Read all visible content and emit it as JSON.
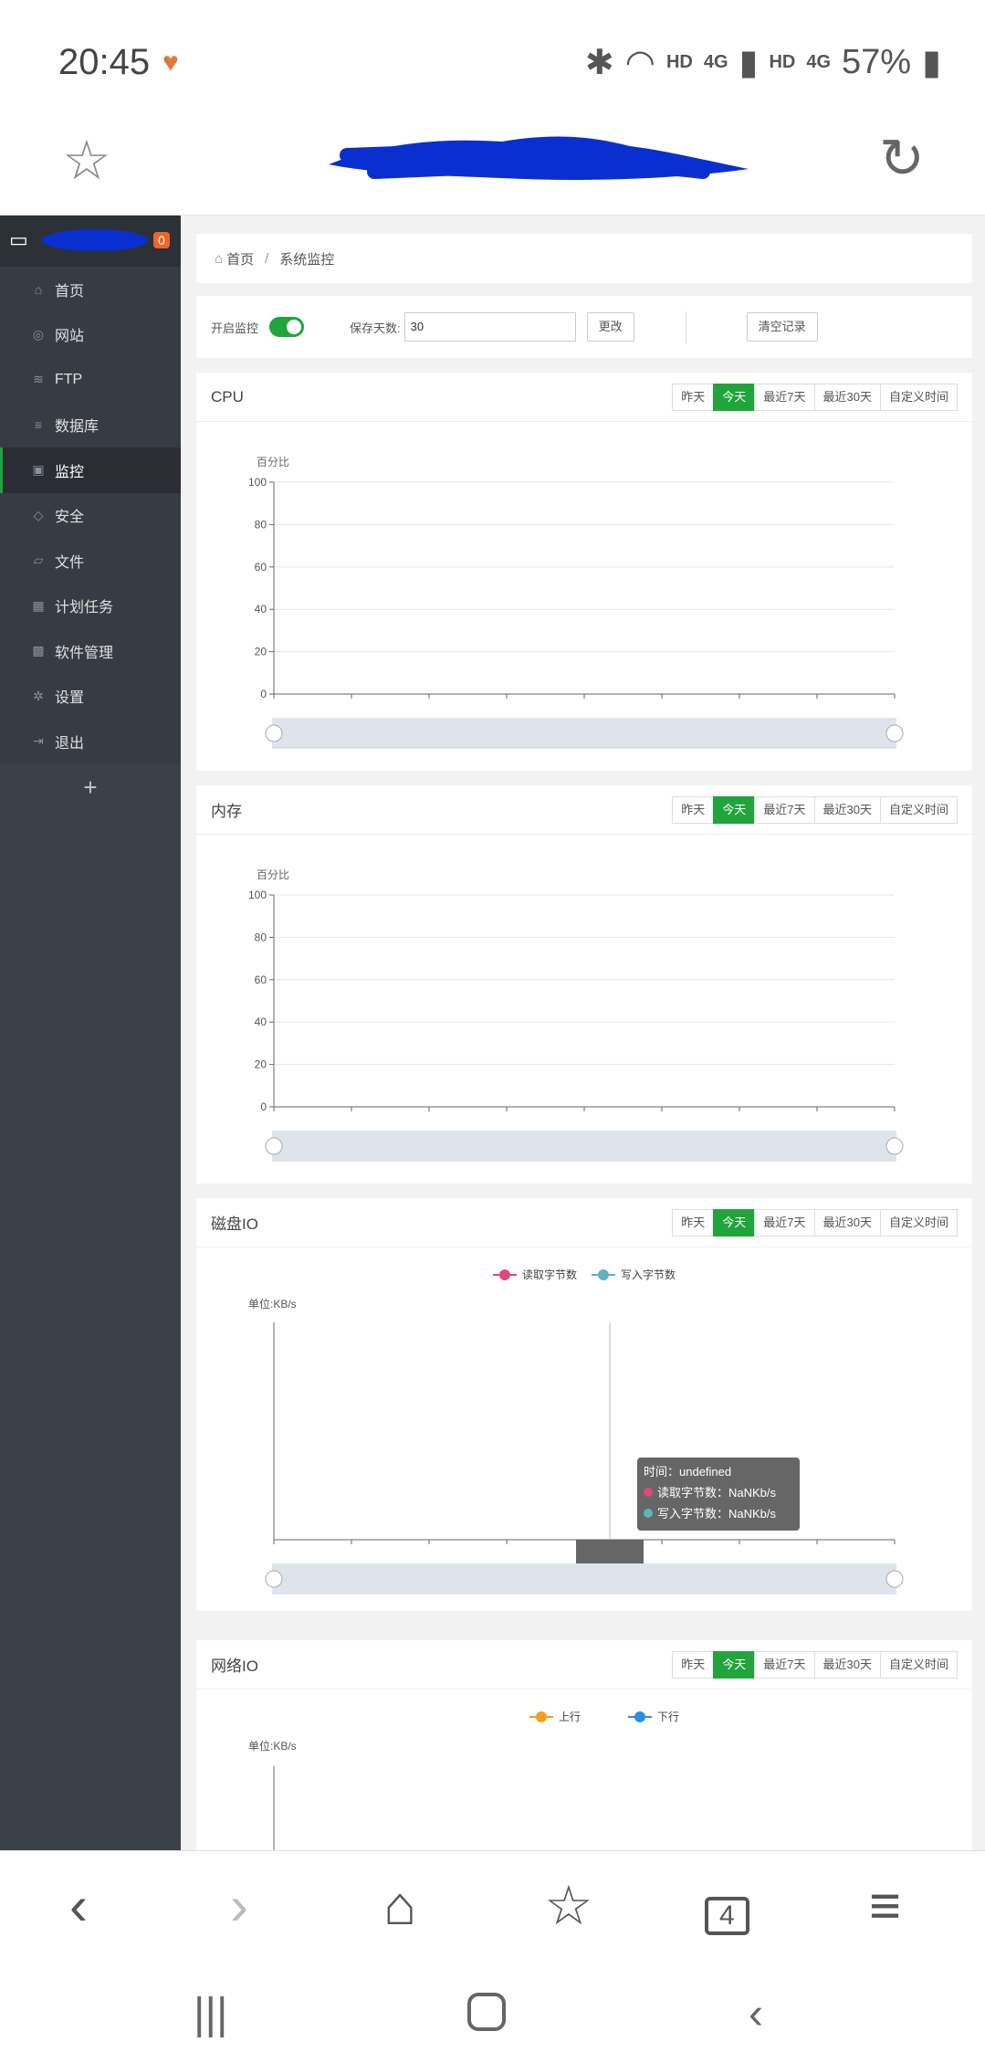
{
  "status_bar": {
    "time": "20:45",
    "hd1": "HD",
    "net1": "4G",
    "hd2": "HD",
    "net2": "4G",
    "battery": "57%"
  },
  "sidebar": {
    "badge": "0",
    "items": [
      {
        "label": "首页",
        "icon": "home-icon"
      },
      {
        "label": "网站",
        "icon": "globe-icon"
      },
      {
        "label": "FTP",
        "icon": "ftp-icon"
      },
      {
        "label": "数据库",
        "icon": "database-icon"
      },
      {
        "label": "监控",
        "icon": "monitor-icon",
        "active": true
      },
      {
        "label": "安全",
        "icon": "shield-icon"
      },
      {
        "label": "文件",
        "icon": "folder-icon"
      },
      {
        "label": "计划任务",
        "icon": "calendar-icon"
      },
      {
        "label": "软件管理",
        "icon": "grid-icon"
      },
      {
        "label": "设置",
        "icon": "gear-icon"
      },
      {
        "label": "退出",
        "icon": "logout-icon"
      }
    ],
    "add": "+"
  },
  "breadcrumb": {
    "home": "首页",
    "sep": "/",
    "current": "系统监控"
  },
  "controls": {
    "enable_label": "开启监控",
    "days_label": "保存天数:",
    "days_value": "30",
    "change_btn": "更改",
    "clear_btn": "清空记录"
  },
  "tabs": [
    "昨天",
    "今天",
    "最近7天",
    "最近30天",
    "自定义时间"
  ],
  "active_tab": "今天",
  "panels": {
    "cpu": {
      "title": "CPU"
    },
    "mem": {
      "title": "内存"
    },
    "disk": {
      "title": "磁盘IO"
    },
    "net": {
      "title": "网络IO"
    }
  },
  "chart_data": [
    {
      "type": "line",
      "title": "CPU",
      "ylabel": "百分比",
      "ylim": [
        0,
        100
      ],
      "yticks": [
        0,
        20,
        40,
        60,
        80,
        100
      ],
      "series": []
    },
    {
      "type": "line",
      "title": "内存",
      "ylabel": "百分比",
      "ylim": [
        0,
        100
      ],
      "yticks": [
        0,
        20,
        40,
        60,
        80,
        100
      ],
      "series": []
    },
    {
      "type": "line",
      "title": "磁盘IO",
      "ylabel": "单位:KB/s",
      "series": [
        {
          "name": "读取字节数",
          "color": "#e2487e",
          "values": []
        },
        {
          "name": "写入字节数",
          "color": "#5fb2c2",
          "values": []
        }
      ],
      "tooltip": {
        "time": "时间：undefined",
        "read": "读取字节数：NaNKb/s",
        "write": "写入字节数：NaNKb/s"
      }
    },
    {
      "type": "line",
      "title": "网络IO",
      "ylabel": "单位:KB/s",
      "series": [
        {
          "name": "上行",
          "color": "#f39c1d",
          "values": []
        },
        {
          "name": "下行",
          "color": "#2e8de5",
          "values": []
        }
      ]
    }
  ],
  "browser": {
    "tab_count": "4"
  }
}
